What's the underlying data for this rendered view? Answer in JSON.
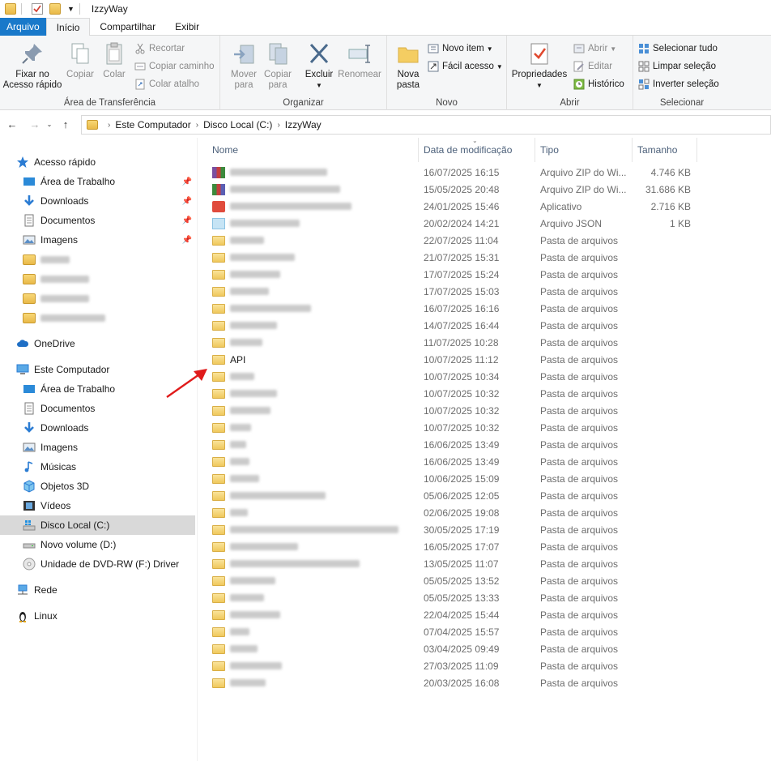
{
  "window": {
    "title": "IzzyWay"
  },
  "tabs": [
    {
      "label": "Arquivo"
    },
    {
      "label": "Início"
    },
    {
      "label": "Compartilhar"
    },
    {
      "label": "Exibir"
    }
  ],
  "ribbon": {
    "clipboard": {
      "label": "Área de Transferência",
      "pin": "Fixar no\nAcesso rápido",
      "copy": "Copiar",
      "paste": "Colar",
      "cut": "Recortar",
      "copy_path": "Copiar caminho",
      "paste_shortcut": "Colar atalho"
    },
    "organize": {
      "label": "Organizar",
      "move": "Mover\npara",
      "copyto": "Copiar\npara",
      "delete": "Excluir",
      "rename": "Renomear"
    },
    "new": {
      "label": "Novo",
      "new_folder": "Nova\npasta",
      "new_item": "Novo item",
      "easy_access": "Fácil acesso"
    },
    "open": {
      "label": "Abrir",
      "properties": "Propriedades",
      "open": "Abrir",
      "edit": "Editar",
      "history": "Histórico"
    },
    "select": {
      "label": "Selecionar",
      "select_all": "Selecionar tudo",
      "select_none": "Limpar seleção",
      "invert": "Inverter seleção"
    }
  },
  "breadcrumb": [
    "Este Computador",
    "Disco Local (C:)",
    "IzzyWay"
  ],
  "sidebar": {
    "quick_access": "Acesso rápido",
    "quick_items": [
      "Área de Trabalho",
      "Downloads",
      "Documentos",
      "Imagens"
    ],
    "onedrive": "OneDrive",
    "this_pc": "Este Computador",
    "pc_items": [
      "Área de Trabalho",
      "Documentos",
      "Downloads",
      "Imagens",
      "Músicas",
      "Objetos 3D",
      "Vídeos",
      "Disco Local (C:)",
      "Novo volume (D:)",
      "Unidade de DVD-RW (F:) Driver"
    ],
    "network": "Rede",
    "linux": "Linux"
  },
  "columns": {
    "name": "Nome",
    "date": "Data de modificação",
    "type": "Tipo",
    "size": "Tamanho"
  },
  "files": [
    {
      "name": "",
      "date": "16/07/2025 16:15",
      "type": "Arquivo ZIP do Wi...",
      "size": "4.746 KB",
      "icon": "zip1"
    },
    {
      "name": "",
      "date": "15/05/2025 20:48",
      "type": "Arquivo ZIP do Wi...",
      "size": "31.686 KB",
      "icon": "zip2"
    },
    {
      "name": "",
      "date": "24/01/2025 15:46",
      "type": "Aplicativo",
      "size": "2.716 KB",
      "icon": "app"
    },
    {
      "name": "",
      "date": "20/02/2024 14:21",
      "type": "Arquivo JSON",
      "size": "1 KB",
      "icon": "json"
    },
    {
      "name": "",
      "date": "22/07/2025 11:04",
      "type": "Pasta de arquivos",
      "size": "",
      "icon": "folder"
    },
    {
      "name": "",
      "date": "21/07/2025 15:31",
      "type": "Pasta de arquivos",
      "size": "",
      "icon": "folder"
    },
    {
      "name": "",
      "date": "17/07/2025 15:24",
      "type": "Pasta de arquivos",
      "size": "",
      "icon": "folder"
    },
    {
      "name": "",
      "date": "17/07/2025 15:03",
      "type": "Pasta de arquivos",
      "size": "",
      "icon": "folder"
    },
    {
      "name": "",
      "date": "16/07/2025 16:16",
      "type": "Pasta de arquivos",
      "size": "",
      "icon": "folder"
    },
    {
      "name": "",
      "date": "14/07/2025 16:44",
      "type": "Pasta de arquivos",
      "size": "",
      "icon": "folder"
    },
    {
      "name": "",
      "date": "11/07/2025 10:28",
      "type": "Pasta de arquivos",
      "size": "",
      "icon": "folder"
    },
    {
      "name": "API",
      "date": "10/07/2025 11:12",
      "type": "Pasta de arquivos",
      "size": "",
      "icon": "folder"
    },
    {
      "name": "",
      "date": "10/07/2025 10:34",
      "type": "Pasta de arquivos",
      "size": "",
      "icon": "folder"
    },
    {
      "name": "",
      "date": "10/07/2025 10:32",
      "type": "Pasta de arquivos",
      "size": "",
      "icon": "folder"
    },
    {
      "name": "",
      "date": "10/07/2025 10:32",
      "type": "Pasta de arquivos",
      "size": "",
      "icon": "folder"
    },
    {
      "name": "",
      "date": "10/07/2025 10:32",
      "type": "Pasta de arquivos",
      "size": "",
      "icon": "folder"
    },
    {
      "name": "",
      "date": "16/06/2025 13:49",
      "type": "Pasta de arquivos",
      "size": "",
      "icon": "folder"
    },
    {
      "name": "",
      "date": "16/06/2025 13:49",
      "type": "Pasta de arquivos",
      "size": "",
      "icon": "folder"
    },
    {
      "name": "",
      "date": "10/06/2025 15:09",
      "type": "Pasta de arquivos",
      "size": "",
      "icon": "folder"
    },
    {
      "name": "",
      "date": "05/06/2025 12:05",
      "type": "Pasta de arquivos",
      "size": "",
      "icon": "folder"
    },
    {
      "name": "",
      "date": "02/06/2025 19:08",
      "type": "Pasta de arquivos",
      "size": "",
      "icon": "folder"
    },
    {
      "name": "",
      "date": "30/05/2025 17:19",
      "type": "Pasta de arquivos",
      "size": "",
      "icon": "folder"
    },
    {
      "name": "",
      "date": "16/05/2025 17:07",
      "type": "Pasta de arquivos",
      "size": "",
      "icon": "folder"
    },
    {
      "name": "",
      "date": "13/05/2025 11:07",
      "type": "Pasta de arquivos",
      "size": "",
      "icon": "folder"
    },
    {
      "name": "",
      "date": "05/05/2025 13:52",
      "type": "Pasta de arquivos",
      "size": "",
      "icon": "folder"
    },
    {
      "name": "",
      "date": "05/05/2025 13:33",
      "type": "Pasta de arquivos",
      "size": "",
      "icon": "folder"
    },
    {
      "name": "",
      "date": "22/04/2025 15:44",
      "type": "Pasta de arquivos",
      "size": "",
      "icon": "folder"
    },
    {
      "name": "",
      "date": "07/04/2025 15:57",
      "type": "Pasta de arquivos",
      "size": "",
      "icon": "folder"
    },
    {
      "name": "",
      "date": "03/04/2025 09:49",
      "type": "Pasta de arquivos",
      "size": "",
      "icon": "folder"
    },
    {
      "name": "",
      "date": "27/03/2025 11:09",
      "type": "Pasta de arquivos",
      "size": "",
      "icon": "folder"
    },
    {
      "name": "",
      "date": "20/03/2025 16:08",
      "type": "Pasta de arquivos",
      "size": "",
      "icon": "folder"
    }
  ],
  "colors": {
    "accent": "#1979ca",
    "selected_bg": "#d9d9d9",
    "annotation_arrow": "#e01b1b"
  }
}
